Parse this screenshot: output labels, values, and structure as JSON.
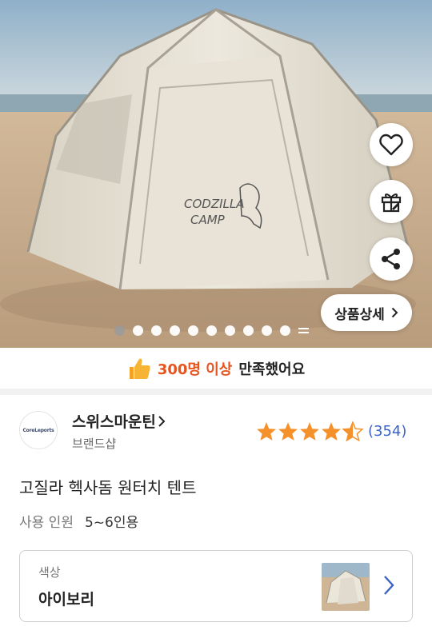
{
  "hero": {
    "slide_count": 11,
    "active_slide": 1,
    "detail_button_label": "상품상세"
  },
  "actions": {
    "heart_icon": "heart-icon",
    "gift_icon": "gift-icon",
    "share_icon": "share-icon"
  },
  "satisfaction": {
    "highlight": "300명 이상",
    "rest": "만족했어요",
    "icon": "thumbs-up-icon"
  },
  "brand": {
    "logo_text": "CoreLeports",
    "name": "스위스마운틴",
    "subtitle": "브랜드샵"
  },
  "rating": {
    "stars": 4.5,
    "count": "(354)",
    "star_color": "#f5912b",
    "count_color": "#3b64c9"
  },
  "product": {
    "title": "고질라 헥사돔 원터치 텐트",
    "spec_label": "사용 인원",
    "spec_value": "5~6인용"
  },
  "option": {
    "label": "색상",
    "value": "아이보리"
  },
  "colors": {
    "accent": "#e8541f",
    "link": "#3b64c9"
  }
}
